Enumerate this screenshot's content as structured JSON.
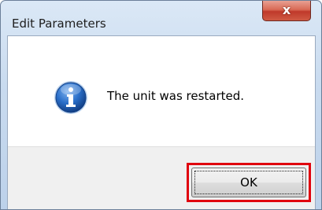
{
  "window": {
    "title": "Edit Parameters",
    "close_icon": "close-icon",
    "close_glyph": "x"
  },
  "message": {
    "icon": "info-icon",
    "text": "The unit was restarted."
  },
  "buttons": {
    "ok_label": "OK"
  },
  "colors": {
    "highlight": "#e0000e",
    "close_button": "#c0392b",
    "info_icon": "#1d5fb4"
  }
}
